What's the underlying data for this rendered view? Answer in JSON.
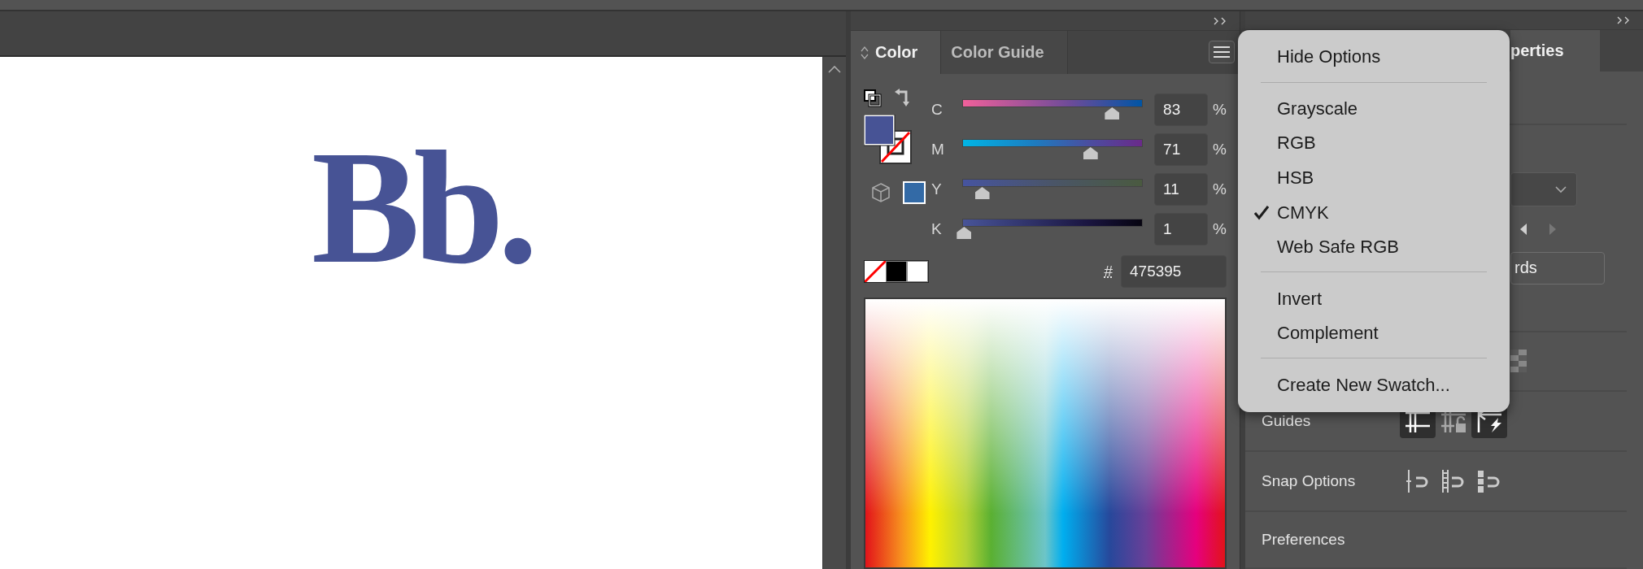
{
  "canvas": {
    "logo_text": "Bb."
  },
  "color_panel": {
    "tabs": [
      {
        "label": "Color",
        "selected": true
      },
      {
        "label": "Color Guide",
        "selected": false
      }
    ],
    "sliders": [
      {
        "label": "C",
        "level": 0.83,
        "value": "83",
        "unit": "%"
      },
      {
        "label": "M",
        "level": 0.71,
        "value": "71",
        "unit": "%"
      },
      {
        "label": "Y",
        "level": 0.11,
        "value": "11",
        "unit": "%"
      },
      {
        "label": "K",
        "level": 0.01,
        "value": "1",
        "unit": "%"
      }
    ],
    "hex": {
      "label": "#",
      "value": "475395"
    }
  },
  "menu": {
    "items": [
      {
        "kind": "item",
        "label": "Hide Options",
        "checked": false
      },
      {
        "kind": "separator"
      },
      {
        "kind": "item",
        "label": "Grayscale",
        "checked": false
      },
      {
        "kind": "item",
        "label": "RGB",
        "checked": false
      },
      {
        "kind": "item",
        "label": "HSB",
        "checked": false
      },
      {
        "kind": "item",
        "label": "CMYK",
        "checked": true
      },
      {
        "kind": "item",
        "label": "Web Safe RGB",
        "checked": false
      },
      {
        "kind": "separator"
      },
      {
        "kind": "item",
        "label": "Invert",
        "checked": false
      },
      {
        "kind": "item",
        "label": "Complement",
        "checked": false
      },
      {
        "kind": "separator"
      },
      {
        "kind": "item",
        "label": "Create New Swatch...",
        "checked": false
      }
    ]
  },
  "properties_panel": {
    "tab": {
      "label": "perties",
      "selected": true
    },
    "button_label": "rds",
    "guides": {
      "label": "Guides",
      "toggles": [
        {
          "on": true
        },
        {
          "on": false
        },
        {
          "on": true
        }
      ]
    },
    "snap_options": {
      "label": "Snap Options"
    },
    "preferences": {
      "label": "Preferences"
    }
  }
}
